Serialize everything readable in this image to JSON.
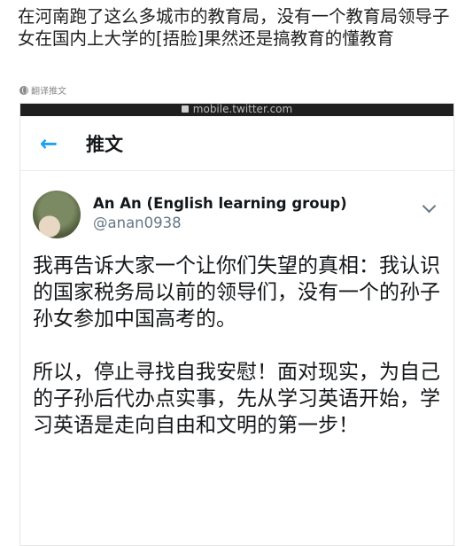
{
  "post": {
    "text": "在河南跑了这么多城市的教育局，没有一个教育局领导子女在国内上大学的[捂脸]果然还是搞教育的懂教育",
    "translate_label": "翻译推文",
    "translate_icon": "globe-icon"
  },
  "browser": {
    "url": "mobile.twitter.com",
    "lock_icon": "lock-icon"
  },
  "tweet_view": {
    "back_icon": "back-arrow-icon",
    "title": "推文",
    "author_name": "An An (English learning group)",
    "author_handle": "@anan0938",
    "menu_icon": "chevron-down-icon",
    "paragraph_1": "我再告诉大家一个让你们失望的真相：我认识的国家税务局以前的领导们，没有一个的孙子孙女参加中国高考的。",
    "paragraph_2": "所以，停止寻找自我安慰！面对现实，为自己的子孙后代办点实事，先从学习英语开始，学习英语是走向自由和文明的第一步！"
  },
  "colors": {
    "accent": "#1da1f2",
    "url_bar": "#1f1f1f",
    "handle": "#657786"
  }
}
